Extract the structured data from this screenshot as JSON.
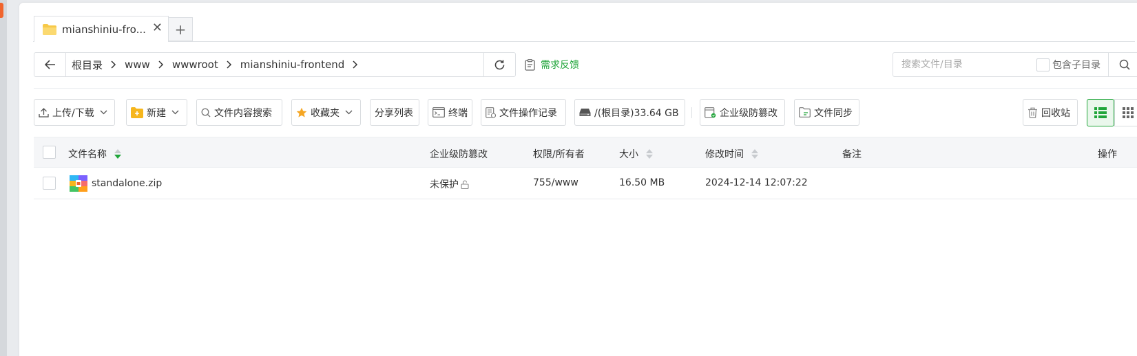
{
  "tabs": [
    {
      "label": "mianshiniu-fro..."
    }
  ],
  "tab_add_label": "+",
  "breadcrumb": [
    "根目录",
    "www",
    "wwwroot",
    "mianshiniu-frontend"
  ],
  "feedback_label": "需求反馈",
  "search": {
    "placeholder": "搜索文件/目录",
    "include_sub_label": "包含子目录"
  },
  "toolbar": {
    "upload": "上传/下载",
    "new": "新建",
    "content_search": "文件内容搜索",
    "favorites": "收藏夹",
    "share_list": "分享列表",
    "terminal": "终端",
    "op_log": "文件操作记录",
    "disk": "/(根目录)33.64 GB",
    "tamper_proof": "企业级防篡改",
    "sync": "文件同步",
    "recycle": "回收站"
  },
  "table": {
    "headers": {
      "name": "文件名称",
      "tamper": "企业级防篡改",
      "perm": "权限/所有者",
      "size": "大小",
      "mtime": "修改时间",
      "note": "备注",
      "action": "操作"
    },
    "rows": [
      {
        "name": "standalone.zip",
        "tamper": "未保护",
        "perm": "755/www",
        "size": "16.50 MB",
        "mtime": "2024-12-14 12:07:22",
        "note": ""
      }
    ]
  },
  "colors": {
    "accent": "#20a53a",
    "border": "#dcdfe3",
    "header_bg": "#f5f6f8"
  }
}
